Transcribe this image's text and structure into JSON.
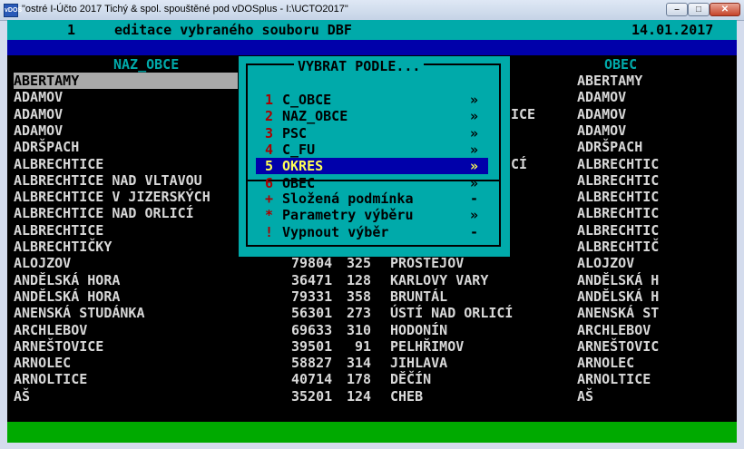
{
  "window": {
    "title": "\"ostré I-Účto 2017 Tichý & spol. spouštěné pod vDOSplus - I:\\UCTO2017\"",
    "app_icon": "vDOS",
    "buttons": {
      "minimize": "–",
      "maximize": "□",
      "close": "✕"
    }
  },
  "header": {
    "number": "1",
    "title": "editace vybraného souboru DBF",
    "date": "14.01.2017"
  },
  "columns": {
    "naz_obce": "NAZ_OBCE",
    "obec": "OBEC"
  },
  "rows": [
    {
      "naz": "ABERTAMY",
      "psc": "",
      "okres": "",
      "okres_name": "",
      "obec": "ABERTAMY"
    },
    {
      "naz": "ADAMOV",
      "psc": "",
      "okres": "",
      "okres_name": "",
      "obec": "ADAMOV"
    },
    {
      "naz": "ADAMOV",
      "psc": "",
      "okres": "",
      "okres_name": "ICE",
      "obec": "ADAMOV"
    },
    {
      "naz": "ADAMOV",
      "psc": "",
      "okres": "",
      "okres_name": "",
      "obec": "ADAMOV"
    },
    {
      "naz": "ADRŠPACH",
      "psc": "",
      "okres": "",
      "okres_name": "",
      "obec": "ADRŠPACH"
    },
    {
      "naz": "ALBRECHTICE",
      "psc": "",
      "okres": "",
      "okres_name": "CÍ",
      "obec": "ALBRECHTIC"
    },
    {
      "naz": "ALBRECHTICE NAD VLTAVOU",
      "psc": "",
      "okres": "",
      "okres_name": "",
      "obec": "ALBRECHTIC"
    },
    {
      "naz": "ALBRECHTICE V JIZERSKÝCH",
      "psc": "",
      "okres": "",
      "okres_name": "",
      "obec": "ALBRECHTIC"
    },
    {
      "naz": "ALBRECHTICE NAD ORLICÍ",
      "psc": "",
      "okres": "",
      "okres_name": "",
      "obec": "ALBRECHTIC"
    },
    {
      "naz": "ALBRECHTICE",
      "psc": "",
      "okres": "",
      "okres_name": "",
      "obec": "ALBRECHTIC"
    },
    {
      "naz": "ALBRECHTIČKY",
      "psc": "",
      "okres": "",
      "okres_name": "",
      "obec": "ALBRECHTIČ"
    },
    {
      "naz": "ALOJZOV",
      "psc": "79804",
      "okres": "325",
      "okres_name": "PROSTĚJOV",
      "obec": "ALOJZOV"
    },
    {
      "naz": "ANDĚLSKÁ HORA",
      "psc": "36471",
      "okres": "128",
      "okres_name": "KARLOVY VARY",
      "obec": "ANDĚLSKÁ H"
    },
    {
      "naz": "ANDĚLSKÁ HORA",
      "psc": "79331",
      "okres": "358",
      "okres_name": "BRUNTÁL",
      "obec": "ANDĚLSKÁ H"
    },
    {
      "naz": "ANENSKÁ STUDÁNKA",
      "psc": "56301",
      "okres": "273",
      "okres_name": "ÚSTÍ NAD ORLICÍ",
      "obec": "ANENSKÁ ST"
    },
    {
      "naz": "ARCHLEBOV",
      "psc": "69633",
      "okres": "310",
      "okres_name": "HODONÍN",
      "obec": "ARCHLEBOV"
    },
    {
      "naz": "ARNEŠTOVICE",
      "psc": "39501",
      "okres": " 91",
      "okres_name": "PELHŘIMOV",
      "obec": "ARNEŠTOVIC"
    },
    {
      "naz": "ARNOLEC",
      "psc": "58827",
      "okres": "314",
      "okres_name": "JIHLAVA",
      "obec": "ARNOLEC"
    },
    {
      "naz": "ARNOLTICE",
      "psc": "40714",
      "okres": "178",
      "okres_name": "DĚČÍN",
      "obec": "ARNOLTICE"
    },
    {
      "naz": "AŠ",
      "psc": "35201",
      "okres": "124",
      "okres_name": "CHEB",
      "obec": "AŠ"
    }
  ],
  "menu": {
    "title": "VYBRAT PODLE...",
    "items": [
      {
        "key": "1",
        "label": "C_OBCE",
        "arrow": "»"
      },
      {
        "key": "2",
        "label": "NAZ_OBCE",
        "arrow": "»"
      },
      {
        "key": "3",
        "label": "PSC",
        "arrow": "»"
      },
      {
        "key": "4",
        "label": "C_FU",
        "arrow": "»"
      },
      {
        "key": "5",
        "label": "OKRES",
        "arrow": "»"
      },
      {
        "key": "6",
        "label": "OBEC",
        "arrow": "»"
      }
    ],
    "extra": [
      {
        "key": "+",
        "label": "Složená podmínka",
        "arrow": "-"
      },
      {
        "key": "*",
        "label": "Parametry výběru",
        "arrow": "»"
      },
      {
        "key": "!",
        "label": "Vypnout výběr",
        "arrow": "-"
      }
    ],
    "highlighted_index": 4
  },
  "colors": {
    "cyan": "#00aaaa",
    "blue": "#0000aa",
    "green": "#00aa00",
    "highlight_text": "#ffff55",
    "hotkey": "#aa0000"
  }
}
